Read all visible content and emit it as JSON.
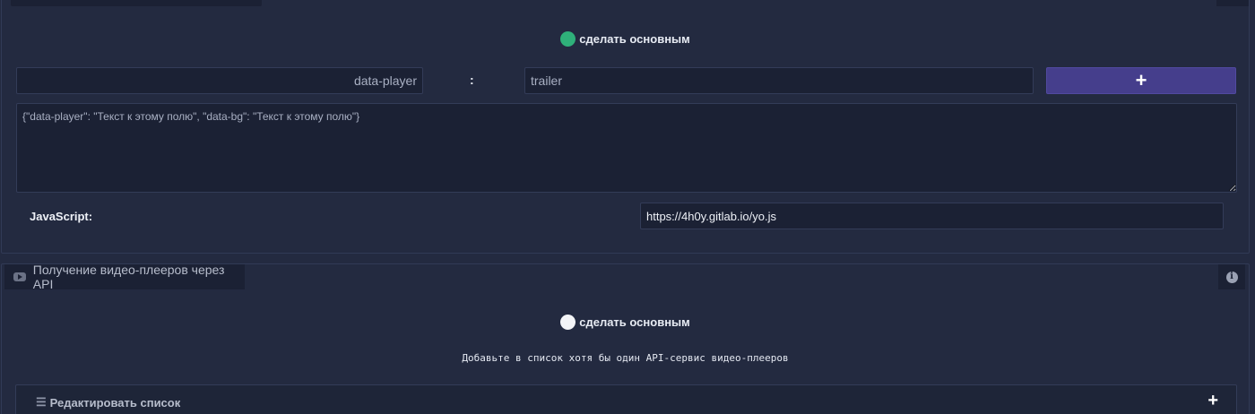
{
  "panel1": {
    "make_main_label": "сделать основным",
    "key_input_value": "data-player",
    "separator": ":",
    "value_input_value": "trailer",
    "add_label": "+",
    "attributes_json": "{\"data-player\": \"Текст к этому полю\", \"data-bg\": \"Текст к этому полю\"}",
    "js_label": "JavaScript:",
    "js_url": "https://4h0y.gitlab.io/yo.js",
    "main_dot_color": "#2fb07a"
  },
  "panel2": {
    "tab_label": "Получение видео-плееров через API",
    "tab_icon": "youtube-icon",
    "info_icon": "info-icon",
    "info_glyph": "i",
    "make_main_label": "сделать основным",
    "main_dot_color": "#f3f4f7",
    "hint": "Добавьте в список хотя бы один API-сервис видео-плееров",
    "edit_list_label": "Редактировать список",
    "edit_list_icon": "list-icon",
    "add_label": "+"
  },
  "colors": {
    "background": "#232a40",
    "accent": "#453e8c"
  }
}
